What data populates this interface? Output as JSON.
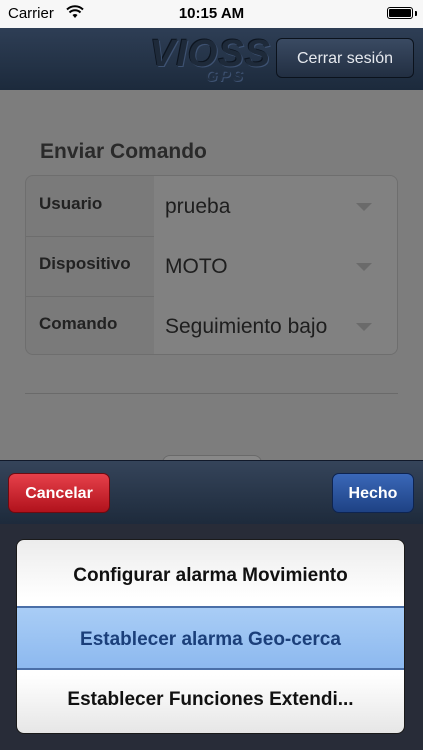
{
  "status_bar": {
    "carrier": "Carrier",
    "time": "10:15 AM"
  },
  "header": {
    "brand": "VIOSS",
    "brand_sub": "GPS",
    "logout_label": "Cerrar sesión"
  },
  "form": {
    "title": "Enviar Comando",
    "rows": [
      {
        "label": "Usuario",
        "value": "prueba"
      },
      {
        "label": "Dispositivo",
        "value": "MOTO"
      },
      {
        "label": "Comando",
        "value": "Seguimiento bajo"
      }
    ]
  },
  "picker": {
    "cancel_label": "Cancelar",
    "done_label": "Hecho",
    "options": [
      "Configurar alarma Movimiento",
      "Establecer alarma Geo-cerca",
      "Establecer Funciones Extendi..."
    ],
    "selected_index": 1
  },
  "colors": {
    "cancel": "#c8202a",
    "done": "#2a55a0",
    "selected_row": "#9fc6f3",
    "header": "#25344a"
  }
}
